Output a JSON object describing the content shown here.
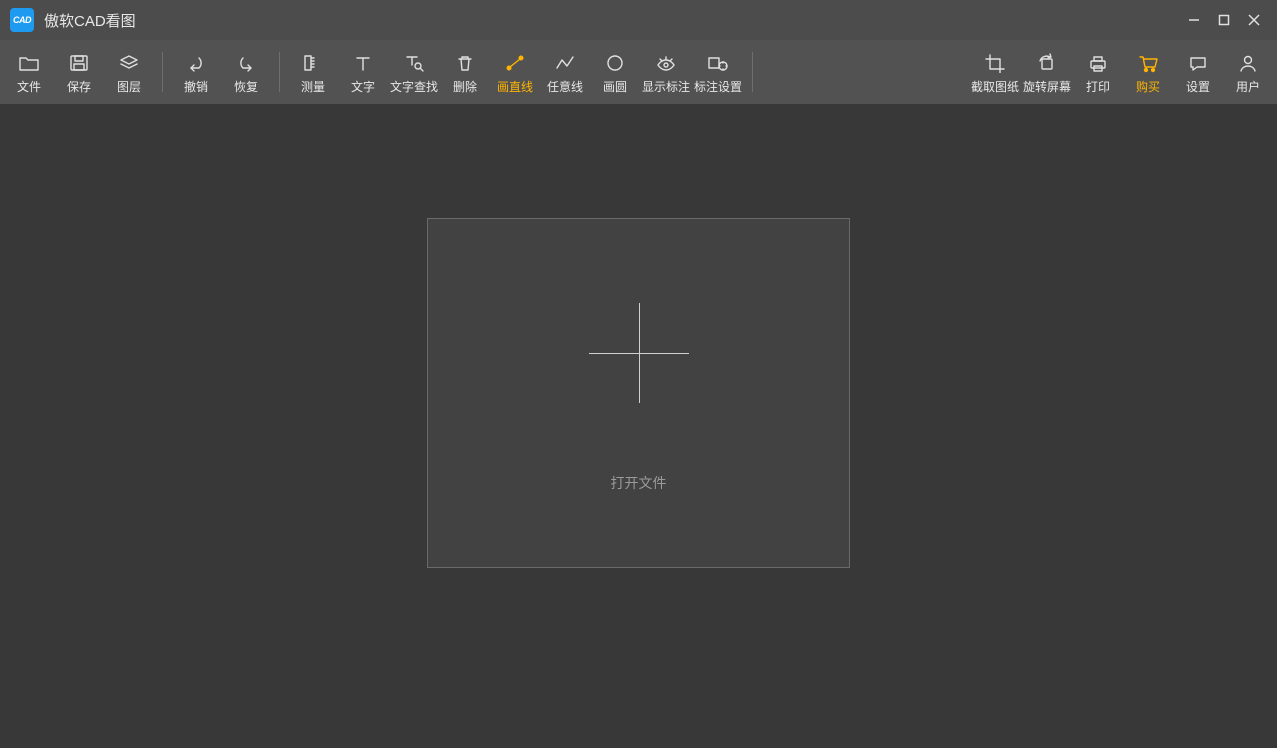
{
  "titlebar": {
    "app_icon_text": "CAD",
    "title": "傲软CAD看图"
  },
  "toolbar": {
    "groups": [
      [
        {
          "id": "file",
          "label": "文件",
          "icon": "folder"
        },
        {
          "id": "save",
          "label": "保存",
          "icon": "save"
        },
        {
          "id": "layers",
          "label": "图层",
          "icon": "layers"
        }
      ],
      [
        {
          "id": "undo",
          "label": "撤销",
          "icon": "undo"
        },
        {
          "id": "redo",
          "label": "恢复",
          "icon": "redo"
        }
      ],
      [
        {
          "id": "measure",
          "label": "测量",
          "icon": "measure"
        },
        {
          "id": "text",
          "label": "文字",
          "icon": "text"
        },
        {
          "id": "findtext",
          "label": "文字查找",
          "icon": "findtext"
        },
        {
          "id": "delete",
          "label": "删除",
          "icon": "trash"
        },
        {
          "id": "line",
          "label": "画直线",
          "icon": "line",
          "accent": true
        },
        {
          "id": "polyline",
          "label": "任意线",
          "icon": "polyline"
        },
        {
          "id": "circle",
          "label": "画圆",
          "icon": "circle"
        },
        {
          "id": "showmark",
          "label": "显示标注",
          "icon": "eye"
        },
        {
          "id": "marksettings",
          "label": "标注设置",
          "icon": "marksettings"
        }
      ],
      [
        {
          "id": "crop",
          "label": "截取图纸",
          "icon": "crop"
        },
        {
          "id": "rotate",
          "label": "旋转屏幕",
          "icon": "rotate"
        },
        {
          "id": "print",
          "label": "打印",
          "icon": "print"
        },
        {
          "id": "purchase",
          "label": "购买",
          "icon": "cart",
          "accent": true
        },
        {
          "id": "chat",
          "label": "设置",
          "icon": "chat"
        },
        {
          "id": "user",
          "label": "用户",
          "icon": "user"
        }
      ]
    ]
  },
  "content": {
    "open_label": "打开文件"
  }
}
